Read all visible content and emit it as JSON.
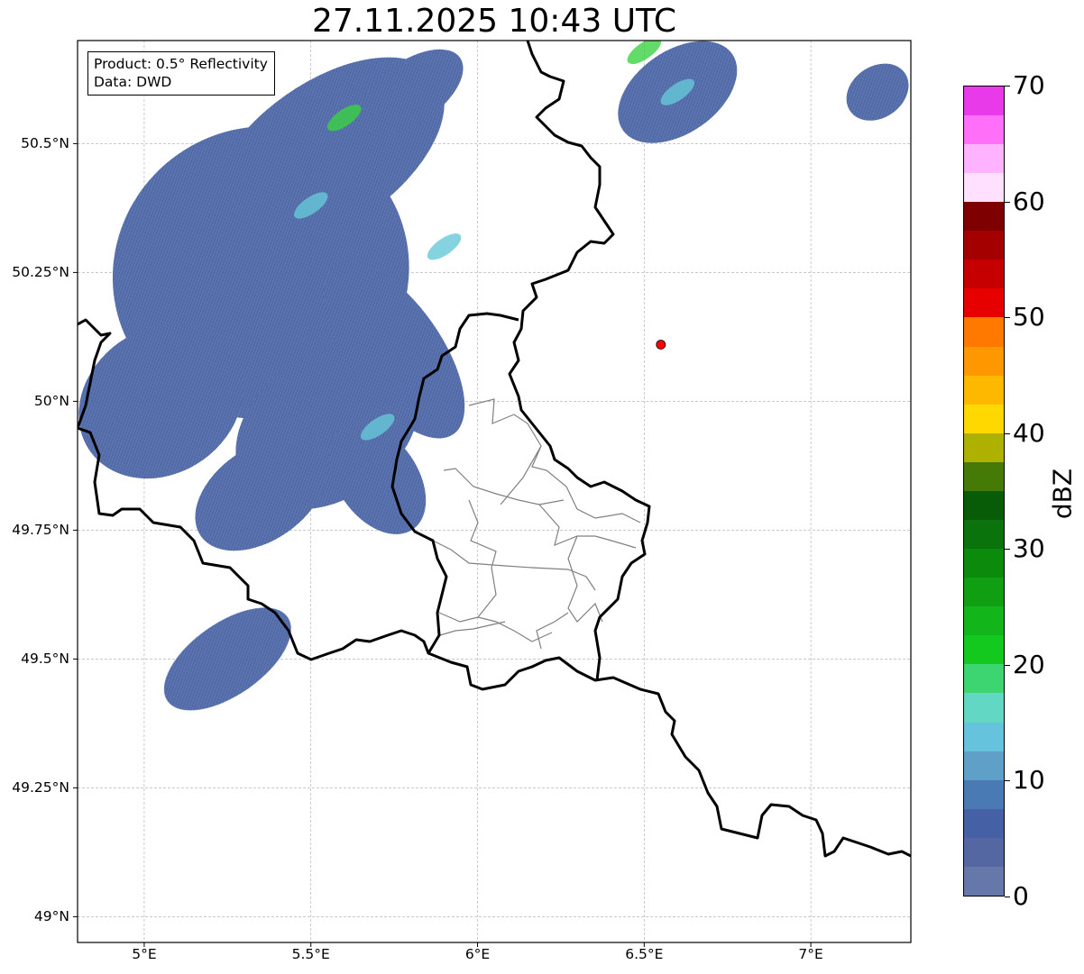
{
  "title": "27.11.2025 10:43 UTC",
  "info": {
    "product": "Product: 0.5° Reflectivity",
    "data": "Data: DWD"
  },
  "map": {
    "lon_range": [
      4.8,
      7.3
    ],
    "lat_range": [
      48.95,
      50.7
    ],
    "lat_ticks": [
      {
        "value": 49.0,
        "label": "49°N"
      },
      {
        "value": 49.25,
        "label": "49.25°N"
      },
      {
        "value": 49.5,
        "label": "49.5°N"
      },
      {
        "value": 49.75,
        "label": "49.75°N"
      },
      {
        "value": 50.0,
        "label": "50°N"
      },
      {
        "value": 50.25,
        "label": "50.25°N"
      },
      {
        "value": 50.5,
        "label": "50.5°N"
      }
    ],
    "lon_ticks": [
      {
        "value": 5.0,
        "label": "5°E"
      },
      {
        "value": 5.5,
        "label": "5.5°E"
      },
      {
        "value": 6.0,
        "label": "6°E"
      },
      {
        "value": 6.5,
        "label": "6.5°E"
      },
      {
        "value": 7.0,
        "label": "7°E"
      }
    ],
    "grid": true,
    "radar_site": {
      "lon": 6.55,
      "lat": 50.11,
      "color": "#ff0000"
    }
  },
  "colorbar": {
    "unit": "dBZ",
    "min": 0,
    "max": 70,
    "step": 2.5,
    "tick_labels": [
      "0",
      "10",
      "20",
      "30",
      "40",
      "50",
      "60",
      "70"
    ],
    "colors": [
      "#6677aa",
      "#5567a3",
      "#4660a5",
      "#4a7ab3",
      "#5ea0c8",
      "#66c3dd",
      "#62d7c4",
      "#3dd472",
      "#13c91e",
      "#12b61a",
      "#109e12",
      "#0c8a0c",
      "#0b730b",
      "#085c08",
      "#467a07",
      "#aeb100",
      "#ffd800",
      "#ffb800",
      "#ff9800",
      "#ff7800",
      "#e60000",
      "#c60000",
      "#a40000",
      "#7f0000",
      "#ffe0ff",
      "#ffb3ff",
      "#ff6ff7",
      "#e93ae9"
    ]
  },
  "precip_fields": [
    {
      "lon": 5.35,
      "lat": 50.25,
      "rx": 0.45,
      "ry": 0.28
    },
    {
      "lon": 5.55,
      "lat": 50.48,
      "rx": 0.4,
      "ry": 0.14
    },
    {
      "lon": 5.05,
      "lat": 50.0,
      "rx": 0.26,
      "ry": 0.14
    },
    {
      "lon": 5.55,
      "lat": 49.95,
      "rx": 0.3,
      "ry": 0.14
    },
    {
      "lon": 5.35,
      "lat": 49.82,
      "rx": 0.22,
      "ry": 0.09
    },
    {
      "lon": 5.75,
      "lat": 50.1,
      "rx": 0.14,
      "ry": 0.2
    },
    {
      "lon": 5.25,
      "lat": 49.5,
      "rx": 0.22,
      "ry": 0.07
    },
    {
      "lon": 5.7,
      "lat": 49.85,
      "rx": 0.12,
      "ry": 0.12
    },
    {
      "lon": 6.6,
      "lat": 50.6,
      "rx": 0.2,
      "ry": 0.08
    },
    {
      "lon": 7.2,
      "lat": 50.6,
      "rx": 0.1,
      "ry": 0.05
    },
    {
      "lon": 5.8,
      "lat": 50.6,
      "rx": 0.18,
      "ry": 0.06
    }
  ]
}
